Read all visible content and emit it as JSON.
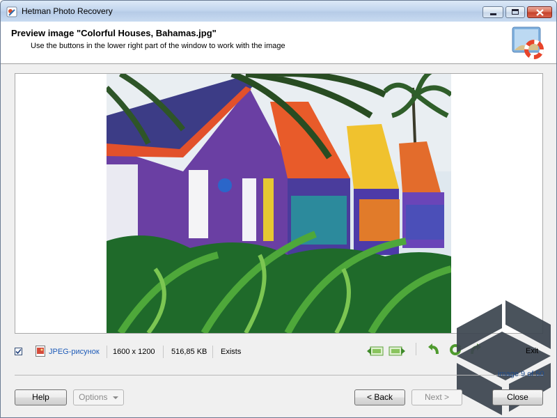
{
  "window": {
    "title": "Hetman Photo Recovery"
  },
  "header": {
    "title": "Preview image \"Colorful Houses, Bahamas.jpg\"",
    "subtitle": "Use the buttons in the lower right part of the window to work with the image"
  },
  "status": {
    "file_type": "JPEG-рисунок",
    "dimensions": "1600 x 1200",
    "size": "516,85 KB",
    "state": "Exists",
    "checkbox_checked": true
  },
  "toolbar": {
    "exit_label": "Exit",
    "counter": "image 9 of 50",
    "icons": [
      "previous-image-icon",
      "next-image-icon",
      "rotate-left-icon",
      "rotate-reset-icon",
      "rotate-right-icon"
    ]
  },
  "buttons": {
    "help": "Help",
    "options": "Options",
    "back": "< Back",
    "next": "Next >",
    "close": "Close"
  },
  "colors": {
    "accent_green": "#5da03a",
    "title_blue": "#c3d6ee",
    "link_blue": "#1e5bb8"
  }
}
